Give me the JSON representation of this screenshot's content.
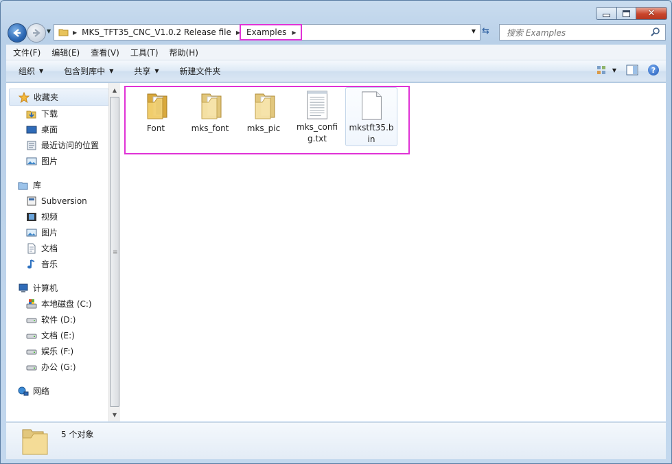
{
  "address": {
    "crumbs": [
      "MKS_TFT35_CNC_V1.0.2 Release file",
      "Examples"
    ]
  },
  "search": {
    "placeholder": "搜索 Examples"
  },
  "menu": [
    "文件(F)",
    "编辑(E)",
    "查看(V)",
    "工具(T)",
    "帮助(H)"
  ],
  "toolbar": {
    "organize": "组织",
    "include_library": "包含到库中",
    "share": "共享",
    "new_folder": "新建文件夹"
  },
  "nav": {
    "favorites": {
      "label": "收藏夹",
      "items": [
        "下载",
        "桌面",
        "最近访问的位置",
        "图片"
      ]
    },
    "libraries": {
      "label": "库",
      "items": [
        "Subversion",
        "视频",
        "图片",
        "文档",
        "音乐"
      ]
    },
    "computer": {
      "label": "计算机",
      "items": [
        "本地磁盘 (C:)",
        "软件 (D:)",
        "文档 (E:)",
        "娱乐 (F:)",
        "办公 (G:)"
      ]
    },
    "network": {
      "label": "网络"
    }
  },
  "files": [
    {
      "name": "Font",
      "type": "folder"
    },
    {
      "name": "mks_font",
      "type": "folder"
    },
    {
      "name": "mks_pic",
      "type": "folder"
    },
    {
      "name": "mks_config.txt",
      "type": "text"
    },
    {
      "name": "mkstft35.bin",
      "type": "file"
    }
  ],
  "status": {
    "text": "5 个对象"
  },
  "colors": {
    "highlight": "#e032d6",
    "accent": "#3a6aa7"
  }
}
